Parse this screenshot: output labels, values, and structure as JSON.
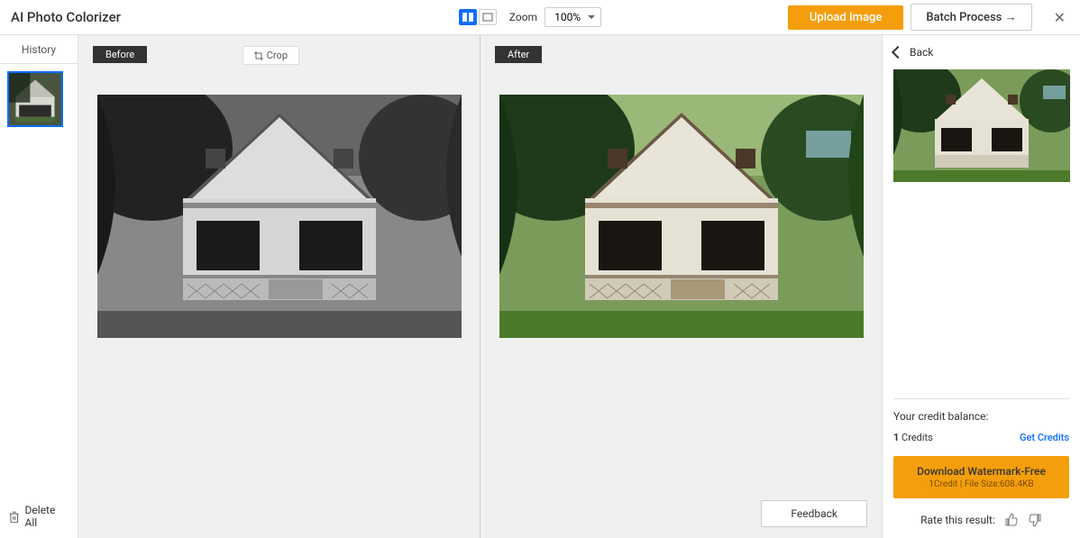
{
  "header": {
    "title": "AI Photo Colorizer",
    "zoom_label": "Zoom",
    "zoom_value": "100%",
    "upload_label": "Upload Image",
    "batch_label": "Batch Process →"
  },
  "sidebar": {
    "history_label": "History",
    "delete_all_label": "Delete All"
  },
  "panes": {
    "before_label": "Before",
    "after_label": "After",
    "crop_label": "Crop",
    "feedback_label": "Feedback"
  },
  "right": {
    "back_label": "Back",
    "credit_balance_label": "Your credit balance:",
    "credit_count": "1",
    "credit_unit": "Credits",
    "get_credits_label": "Get Credits",
    "download_label": "Download Watermark-Free",
    "download_sub": "1Credit | File Size:608.4KB",
    "rate_label": "Rate this result:"
  }
}
